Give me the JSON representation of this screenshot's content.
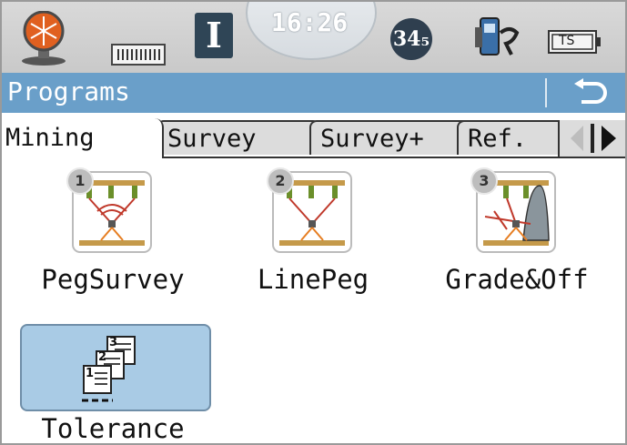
{
  "status_bar": {
    "clock": "16:26",
    "mode_letter": "I",
    "satellites": "34₅",
    "ts_label": "TS",
    "icons": [
      "prism-icon",
      "battery-strip-icon",
      "device-connection-icon",
      "ts-battery-icon"
    ]
  },
  "title_bar": {
    "title": "Programs",
    "back_icon": "back-arrow-icon"
  },
  "tabs": [
    {
      "label": "Mining",
      "active": true
    },
    {
      "label": "Survey",
      "active": false
    },
    {
      "label": "Survey+",
      "active": false
    },
    {
      "label": "Ref.",
      "active": false
    }
  ],
  "apps": [
    {
      "label": "PegSurvey",
      "badge": "1",
      "selected": false
    },
    {
      "label": "LinePeg",
      "badge": "2",
      "selected": false
    },
    {
      "label": "Grade&Off",
      "badge": "3",
      "selected": false
    },
    {
      "label": "Tolerance",
      "badge": "",
      "selected": true
    }
  ],
  "colors": {
    "title_bar": "#6a9fc9",
    "status_bar": "#cfcfcf",
    "selected_tile": "#a9cbe5"
  }
}
